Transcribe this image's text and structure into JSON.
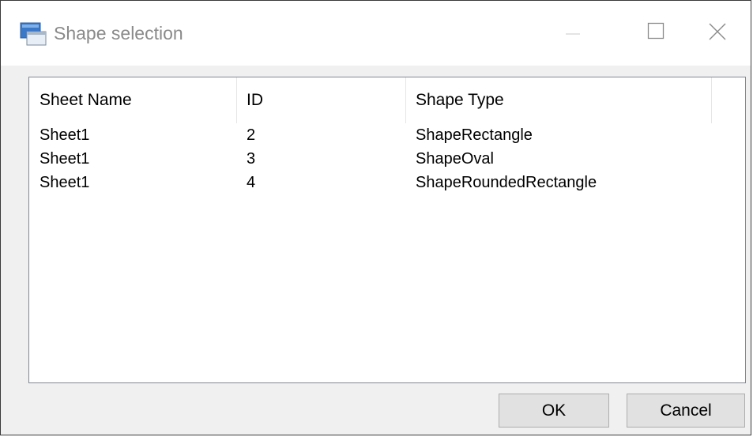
{
  "window": {
    "title": "Shape selection",
    "icon": "window-app-icon",
    "controls": [
      "minimize-icon",
      "maximize-icon",
      "close-icon"
    ]
  },
  "table": {
    "columns": [
      "Sheet Name",
      "ID",
      "Shape Type"
    ],
    "rows": [
      [
        "Sheet1",
        "2",
        "ShapeRectangle"
      ],
      [
        "Sheet1",
        "3",
        "ShapeOval"
      ],
      [
        "Sheet1",
        "4",
        "ShapeRoundedRectangle"
      ]
    ]
  },
  "buttons": {
    "ok": "OK",
    "cancel": "Cancel"
  }
}
